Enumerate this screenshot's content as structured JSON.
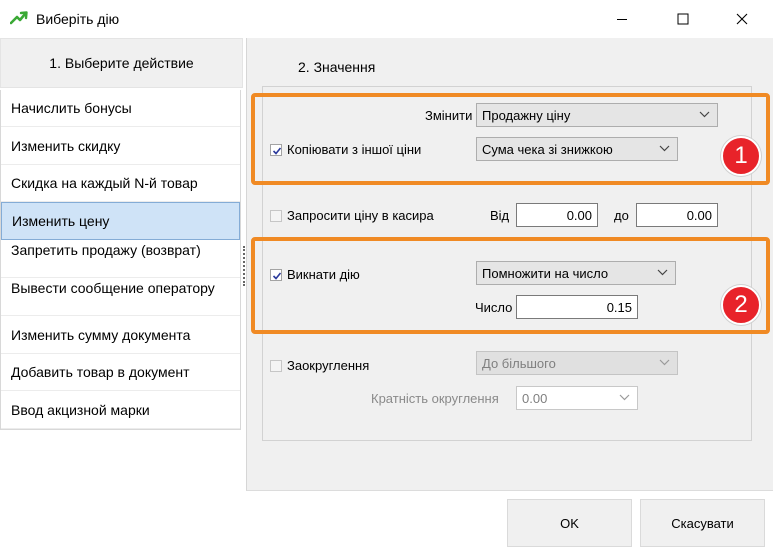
{
  "window": {
    "title": "Виберіть дію",
    "app_icon": "green-arrow-icon",
    "controls": [
      "minimize-icon",
      "maximize-icon",
      "close-icon"
    ]
  },
  "left_panel": {
    "header": "1. Выберите  действие",
    "items": [
      {
        "label": "Начислить бонусы",
        "selected": false
      },
      {
        "label": "Изменить скидку",
        "selected": false
      },
      {
        "label": "Скидка на каждый N-й товар",
        "selected": false
      },
      {
        "label": "Изменить цену",
        "selected": true
      },
      {
        "label": "Запретить продажу (возврат)",
        "selected": false
      },
      {
        "label": "Вывести сообщение оператору",
        "selected": false
      },
      {
        "label": "Изменить сумму документа",
        "selected": false
      },
      {
        "label": "Добавить товар в документ",
        "selected": false
      },
      {
        "label": "Ввод акцизной марки",
        "selected": false
      }
    ]
  },
  "right_panel": {
    "title": "2. Значення",
    "change": {
      "label": "Змінити",
      "value": "Продажну ціну"
    },
    "copy_price": {
      "label": "Копіювати з іншої ціни",
      "checked": true,
      "value": "Сума чека зі знижкою"
    },
    "ask_price": {
      "label": "Запросити ціну в касира",
      "checked": false,
      "from_label": "Від",
      "from_value": "0.00",
      "to_label": "до",
      "to_value": "0.00"
    },
    "action": {
      "label": "Викнати дію",
      "checked": true,
      "value": "Помножити на число"
    },
    "number": {
      "label": "Число",
      "value": "0.15"
    },
    "rounding": {
      "label": "Заокруглення",
      "checked": false,
      "value": "До більшого",
      "multiplicity_label": "Кратність округлення",
      "multiplicity_value": "0.00"
    }
  },
  "annotations": {
    "badge_1": "1",
    "badge_2": "2",
    "highlight_color": "#f08a24",
    "badge_color": "#e8232a"
  },
  "buttons": {
    "ok": "OK",
    "cancel": "Скасувати"
  }
}
